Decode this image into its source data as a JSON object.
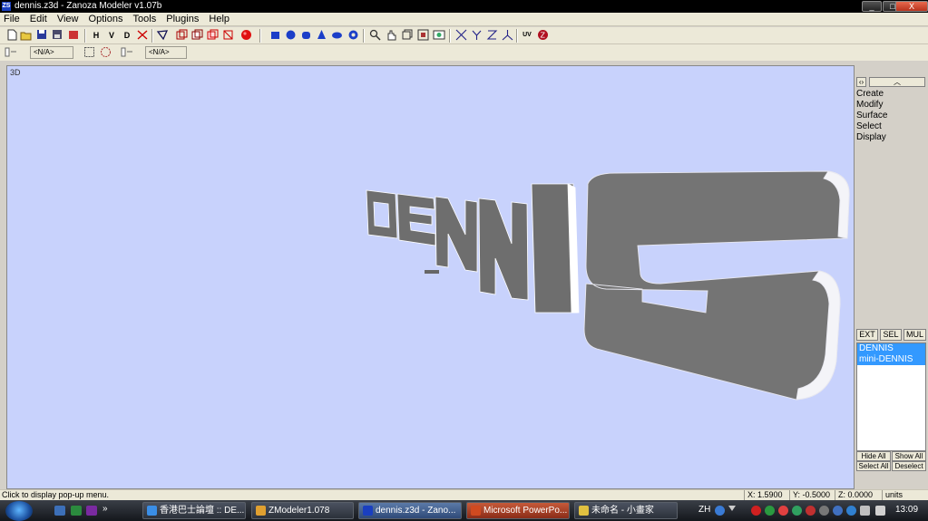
{
  "window": {
    "title": "dennis.z3d - Zanoza Modeler v1.07b",
    "buttons": {
      "minimize": "_",
      "maximize": "□",
      "close": "X"
    }
  },
  "menu": [
    "File",
    "Edit",
    "View",
    "Options",
    "Tools",
    "Plugins",
    "Help"
  ],
  "toolbar": {
    "text_buttons": [
      "H",
      "V",
      "D"
    ],
    "selectors": [
      "<N/A>",
      "<N/A>"
    ],
    "icons": [
      "new-file-icon",
      "open-file-icon",
      "save-icon",
      "save-as-icon",
      "undo-icon",
      "horizontal-icon",
      "vertical-icon",
      "depth-icon",
      "cut-icon",
      "pick-icon",
      "box-view-icon",
      "cube-icon",
      "cube-alt-icon",
      "wire-cube-icon",
      "sphere-render-icon",
      "box-primitive-icon",
      "sphere-primitive-icon",
      "cylinder-primitive-icon",
      "cone-primitive-icon",
      "torus-primitive-icon",
      "gear-primitive-icon",
      "zoom-icon",
      "pan-icon",
      "rotate-icon",
      "fit-icon",
      "camera-icon",
      "axis-x-icon",
      "axis-y-icon",
      "axis-z-icon",
      "axis-xyz-icon",
      "uv-icon",
      "zanoza-icon"
    ]
  },
  "viewport": {
    "label": "3D",
    "model_text": "DENNIS",
    "background": "#c8d2fc"
  },
  "right_panel": {
    "menu_items": [
      "Create",
      "Modify",
      "Surface",
      "Select",
      "Display"
    ],
    "tabs": [
      "EXT",
      "SEL",
      "MUL"
    ],
    "objects": [
      "DENNIS",
      "mini-DENNIS"
    ],
    "buttons": [
      "Hide All",
      "Show All",
      "Select All",
      "Deselect"
    ]
  },
  "status": {
    "message": "Click to display pop-up menu.",
    "x": "X: 1.5900",
    "y": "Y: -0.5000",
    "z": "Z: 0.0000",
    "units": "units"
  },
  "taskbar": {
    "items": [
      {
        "label": "香港巴士論壇 :: DE...",
        "icon_color": "#3a8ee6"
      },
      {
        "label": "ZModeler1.078",
        "icon_color": "#e0a030"
      },
      {
        "label": "dennis.z3d - Zano...",
        "icon_color": "#1a3fc0"
      },
      {
        "label": "Microsoft PowerPo...",
        "icon_color": "#d04a20"
      },
      {
        "label": "未命名 - 小畫家",
        "icon_color": "#e0c040"
      }
    ],
    "lang": "ZH",
    "clock": "13:09"
  }
}
